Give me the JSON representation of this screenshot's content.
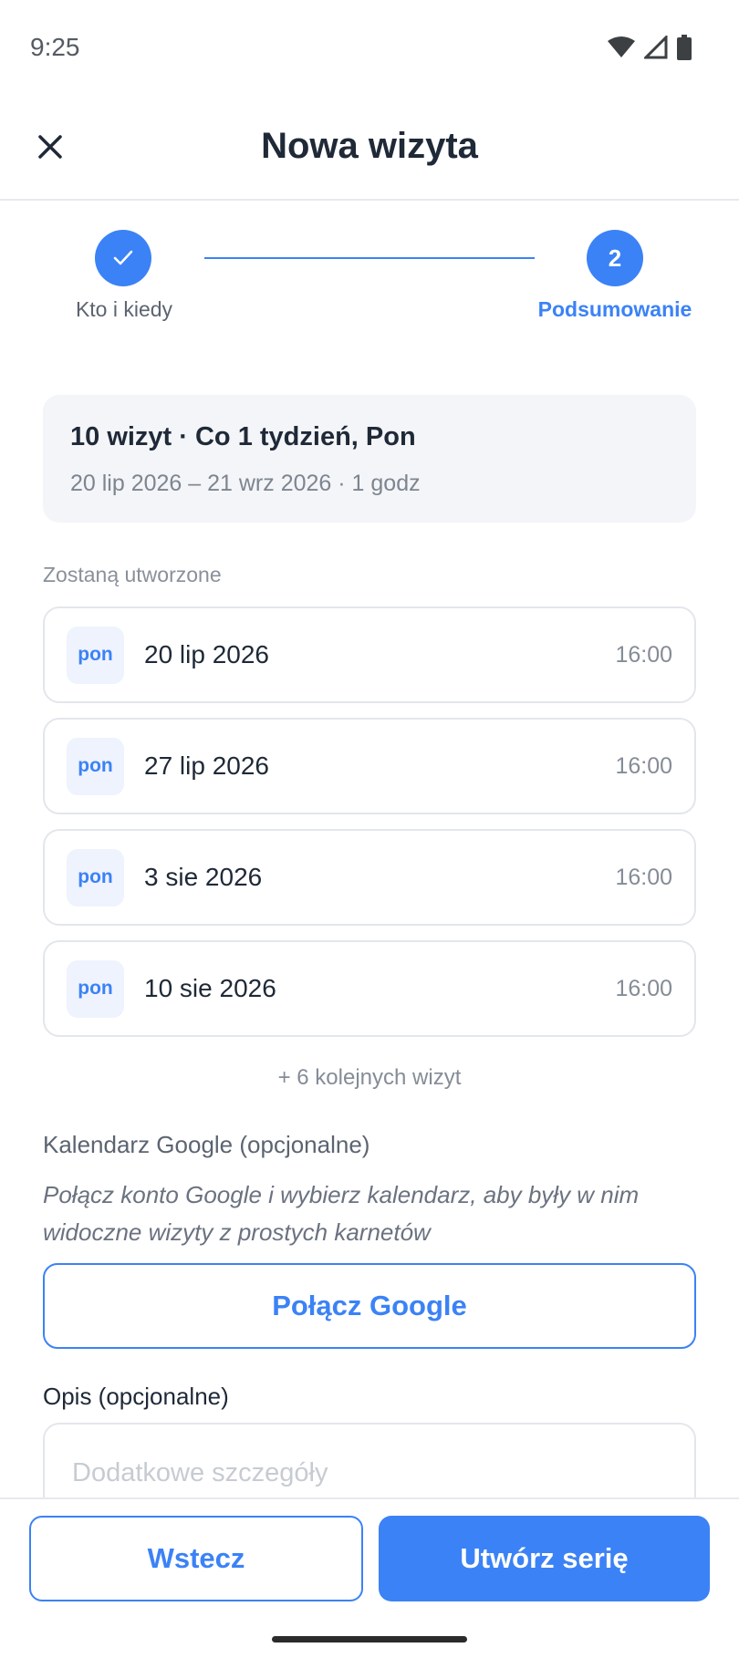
{
  "status_bar": {
    "time": "9:25"
  },
  "header": {
    "title": "Nowa wizyta"
  },
  "stepper": {
    "steps": [
      {
        "label": "Kto i kiedy",
        "state": "completed"
      },
      {
        "number": "2",
        "label": "Podsumowanie",
        "state": "active"
      }
    ]
  },
  "summary": {
    "title": "10 wizyt · Co 1 tydzień, Pon",
    "subtitle": "20 lip 2026 – 21 wrz 2026 · 1 godz"
  },
  "visits_section": {
    "label": "Zostaną utworzone",
    "items": [
      {
        "day": "pon",
        "date": "20 lip 2026",
        "time": "16:00"
      },
      {
        "day": "pon",
        "date": "27 lip 2026",
        "time": "16:00"
      },
      {
        "day": "pon",
        "date": "3 sie 2026",
        "time": "16:00"
      },
      {
        "day": "pon",
        "date": "10 sie 2026",
        "time": "16:00"
      }
    ],
    "more_text": "+ 6 kolejnych wizyt"
  },
  "google_calendar": {
    "label": "Kalendarz Google (opcjonalne)",
    "description": "Połącz konto Google i wybierz kalendarz, aby były w nim widoczne wizyty z prostych karnetów",
    "connect_label": "Połącz Google"
  },
  "description": {
    "label": "Opis (opcjonalne)",
    "value": "",
    "placeholder": "Dodatkowe szczegóły"
  },
  "footer": {
    "back_label": "Wstecz",
    "create_label": "Utwórz serię"
  },
  "colors": {
    "accent": "#3b82f6",
    "badge_bg": "#eef3fd",
    "summary_bg": "#f4f5f8"
  }
}
